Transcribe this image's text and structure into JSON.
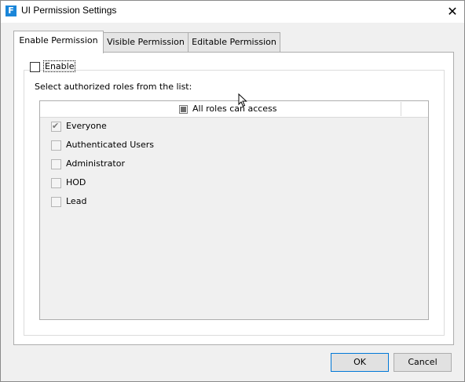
{
  "window": {
    "title": "UI Permission Settings",
    "app_icon_glyph": "F",
    "close_glyph": "✕"
  },
  "tabs": [
    {
      "label": "Enable Permission",
      "active": true
    },
    {
      "label": "Visible Permission",
      "active": false
    },
    {
      "label": "Editable Permission",
      "active": false
    }
  ],
  "enable": {
    "label": "Enable",
    "checked": false
  },
  "select_label": "Select authorized roles from the list:",
  "list": {
    "header_label": "All roles can access",
    "header_state": "indeterminate",
    "roles": [
      {
        "label": "Everyone",
        "checked": true
      },
      {
        "label": "Authenticated Users",
        "checked": false
      },
      {
        "label": "Administrator",
        "checked": false
      },
      {
        "label": "HOD",
        "checked": false
      },
      {
        "label": "Lead",
        "checked": false
      }
    ]
  },
  "buttons": {
    "ok": "OK",
    "cancel": "Cancel"
  },
  "colors": {
    "accent": "#0078d7",
    "app_icon": "#1a86d9",
    "panel": "#ffffff",
    "background": "#f0f0f0"
  }
}
